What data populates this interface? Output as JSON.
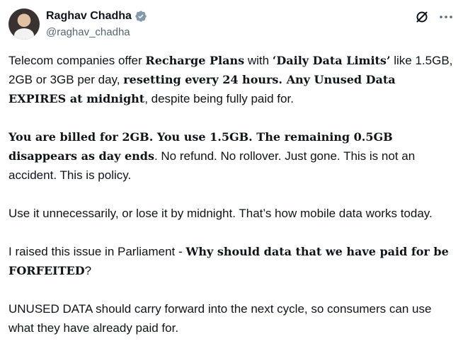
{
  "author": {
    "name": "Raghav Chadha",
    "handle": "@raghav_chadha",
    "verified_icon": "verified-badge-icon",
    "verified_color": "#829aab"
  },
  "actions": {
    "grok_icon": "grok-icon",
    "more_icon": "more-dots-icon"
  },
  "post": {
    "p1": {
      "t1": "Telecom companies offer ",
      "b1": "Recharge Plans",
      "t2": " with ",
      "b2": "‘Daily Data Limits’",
      "t3": " like 1.5GB, 2GB or 3GB per day, ",
      "b3": "resetting every 24 hours. Any Unused Data EXPIRES at midnight",
      "t4": ", despite being fully paid for."
    },
    "p2": {
      "b1": "You are billed for 2GB. You use 1.5GB. The remaining 0.5GB disappears as day ends",
      "t1": ". No refund. No rollover. Just gone. This is not an accident. This is policy."
    },
    "p3": {
      "t1": "Use it unnecessarily, or lose it by midnight. That’s how mobile data works today."
    },
    "p4": {
      "t1": "I raised this issue in Parliament - ",
      "b1": "Why should data that we have paid for be FORFEITED",
      "t2": "?"
    },
    "p5": {
      "t1": "UNUSED DATA should carry forward into the next cycle, so consumers can use what they have already paid for."
    }
  }
}
